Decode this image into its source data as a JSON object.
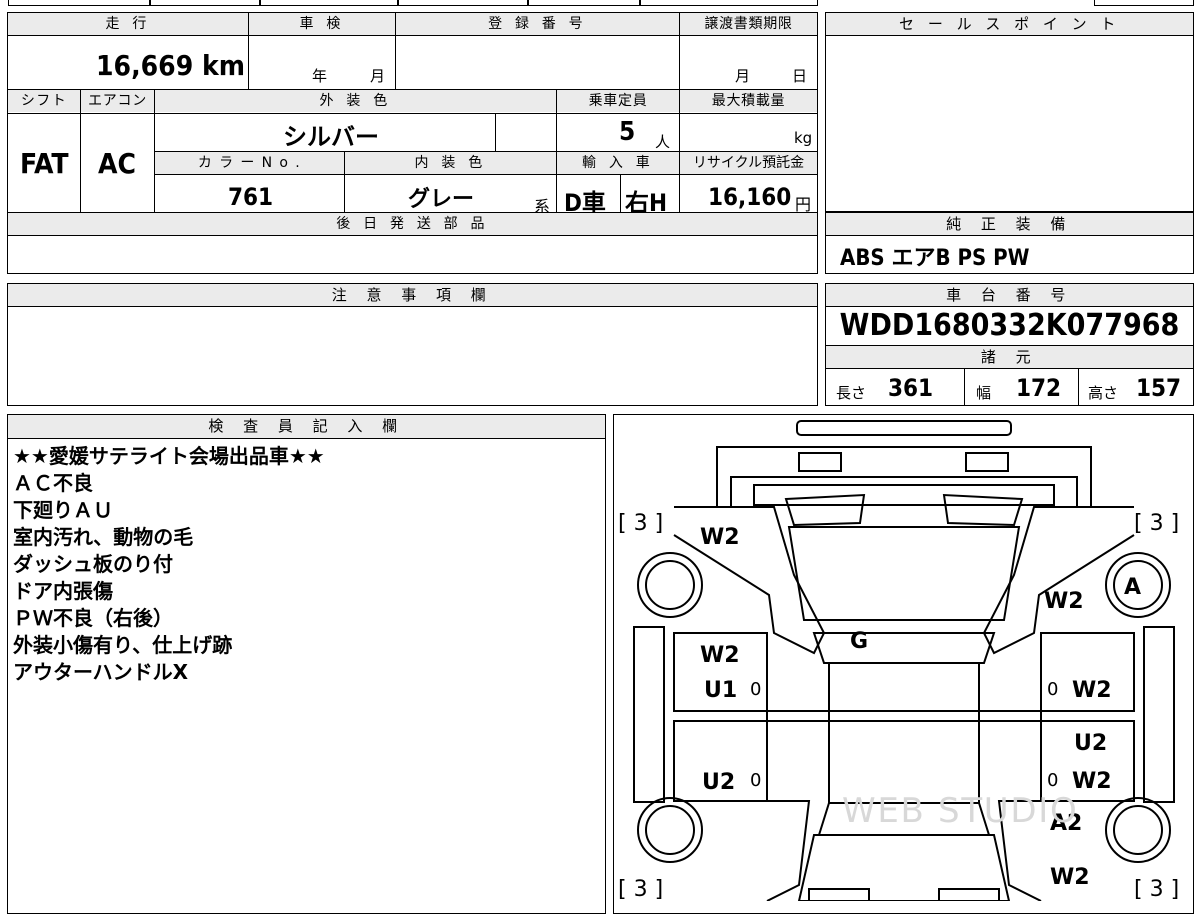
{
  "top_grid": {
    "mileage_label": "走 行",
    "mileage_value": "16,669 km",
    "inspection_label": "車 検",
    "inspection_year": "年",
    "inspection_month": "月",
    "registration_label": "登 録 番 号",
    "transfer_label": "譲渡書類期限",
    "transfer_month": "月",
    "transfer_day": "日",
    "shift_label": "シフト",
    "shift_value": "FAT",
    "aircon_label": "エアコン",
    "aircon_value": "AC",
    "exterior_label": "外 装 色",
    "exterior_value": "シルバー",
    "capacity_label": "乗車定員",
    "capacity_value": "5",
    "capacity_unit": "人",
    "max_load_label": "最大積載量",
    "max_load_unit": "kg",
    "color_no_label": "カ ラ ー N o .",
    "color_no_value": "761",
    "interior_label": "内 装 色",
    "interior_value": "グレー",
    "interior_suffix": "系",
    "import_label": "輸 入 車",
    "import_type": "D車",
    "import_steering": "右H",
    "recycle_label": "リサイクル預託金",
    "recycle_value": "16,160",
    "recycle_unit": "円",
    "later_parts_label": "後 日 発 送 部 品"
  },
  "sales_point": {
    "label": "セ ー ル ス ポ イ ン ト"
  },
  "equipment": {
    "label": "純 正 装 備",
    "value": "ABS エアB PS PW"
  },
  "notes": {
    "label": "注 意 事 項 欄"
  },
  "chassis": {
    "label": "車 台 番 号",
    "value": "WDD1680332K077968",
    "specs_label": "諸 元",
    "length_label": "長さ",
    "length_value": "361",
    "width_label": "幅",
    "width_value": "172",
    "height_label": "高さ",
    "height_value": "157"
  },
  "inspector": {
    "label": "検 査 員 記 入 欄",
    "lines": [
      "★★愛媛サテライト会場出品車★★",
      "ＡＣ不良",
      "下廻りＡＵ",
      "室内汚れ、動物の毛",
      "ダッシュ板のり付",
      "ドア内張傷",
      "ＰＷ不良（右後）",
      "外装小傷有り、仕上げ跡",
      "アウターハンドルX"
    ]
  },
  "diagram": {
    "tire_front_left": "3",
    "tire_front_right": "3",
    "tire_rear_left": "3",
    "tire_rear_right": "3",
    "fender_fl": "W2",
    "fender_fr": "W2",
    "wheel_fr": "A",
    "windshield": "G",
    "door_fl_1": "W2",
    "door_fl_2": "U1",
    "door_fl_zero": "0",
    "door_fr_zero": "0",
    "door_fr": "W2",
    "door_rr_1": "U2",
    "door_rr_zero": "0",
    "door_rr_2": "W2",
    "door_rl": "U2",
    "door_rl_zero": "0",
    "quarter_rr": "A2",
    "rear_r": "W2",
    "watermark": "WEB STUDIO"
  }
}
